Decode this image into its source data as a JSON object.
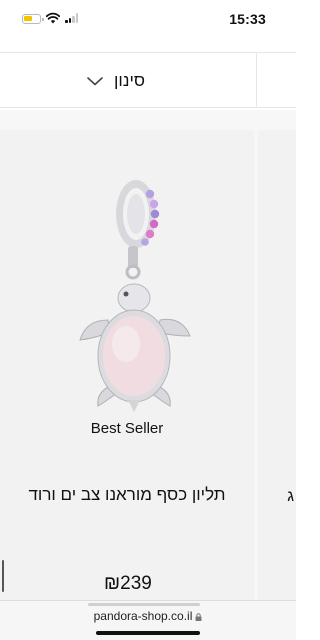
{
  "status_bar": {
    "time": "15:33",
    "battery_level": 0.4,
    "battery_color": "#f5c400"
  },
  "filter": {
    "label": "סינון",
    "icon": "chevron-down-icon"
  },
  "product": {
    "badge": "Best Seller",
    "title": "תליון כסף מוראנו צב ים ורוד",
    "price": "₪239",
    "image": "pink-murano-sea-turtle-dangle-charm"
  },
  "next_product": {
    "title_peek": "ג"
  },
  "browser": {
    "url": "pandora-shop.co.il",
    "icon": "lock-icon"
  }
}
